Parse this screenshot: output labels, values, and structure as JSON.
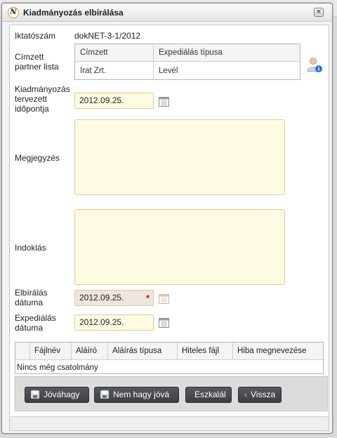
{
  "window": {
    "title": "Kiadmányozás elbírálása",
    "logo_letter": "N"
  },
  "form": {
    "iktatoszam_label": "Iktatószám",
    "iktatoszam_value": "dokNET-3-1/2012",
    "partner_label": "Címzett partner lista",
    "partner_table": {
      "columns": [
        "Címzett",
        "Expediálás típusa"
      ],
      "rows": [
        [
          "Irat Zrt.",
          "Levél"
        ]
      ]
    },
    "planned_date_label": "Kiadmányozás tervezett időpontja",
    "planned_date_value": "2012.09.25.",
    "megjegyzes_label": "Megjegyzés",
    "megjegyzes_value": "",
    "indoklas_label": "Indoklás",
    "indoklas_value": "",
    "decision_date_label": "Elbírálás dátuma",
    "decision_date_value": "2012.09.25.",
    "required_mark": "*",
    "expedition_date_label": "Expediálás dátuma",
    "expedition_date_value": "2012.09.25."
  },
  "attachments": {
    "columns": [
      "Fájlnév",
      "Aláíró",
      "Aláírás típusa",
      "Hiteles fájl",
      "Hiba megnevezése"
    ],
    "empty_text": "Nincs még csatolmány"
  },
  "buttons": {
    "approve": "Jóváhagy",
    "reject": "Nem hagy jóvá",
    "escalate": "Eszkalál",
    "back": "Vissza"
  },
  "colors": {
    "input_bg": "#fffbe3",
    "readonly_bg": "#efe6dd",
    "button_bg": "#45484d",
    "required": "#b22222"
  },
  "icons": {
    "calendar": "calendar-icon",
    "user_info": "user-info-icon",
    "save": "floppy-icon",
    "back": "chevron-left-icon"
  }
}
